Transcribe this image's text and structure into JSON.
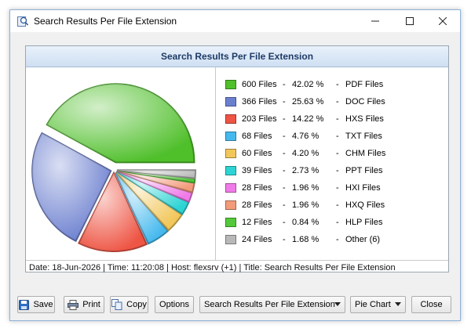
{
  "window": {
    "title": "Search Results Per File Extension"
  },
  "chart_data": {
    "type": "pie",
    "title": "Search Results Per File Extension",
    "slices": [
      {
        "files": "600 Files",
        "percent": "42.02 %",
        "label": "PDF Files",
        "value": 600,
        "color": "#4fbf2a"
      },
      {
        "files": "366 Files",
        "percent": "25.63 %",
        "label": "DOC Files",
        "value": 366,
        "color": "#6b7fcf"
      },
      {
        "files": "203 Files",
        "percent": "14.22 %",
        "label": "HXS Files",
        "value": 203,
        "color": "#ee5544"
      },
      {
        "files": "68 Files",
        "percent": "4.76 %",
        "label": "TXT Files",
        "value": 68,
        "color": "#45b9ee"
      },
      {
        "files": "60 Files",
        "percent": "4.20 %",
        "label": "CHM Files",
        "value": 60,
        "color": "#f2c75a"
      },
      {
        "files": "39 Files",
        "percent": "2.73 %",
        "label": "PPT Files",
        "value": 39,
        "color": "#2ed4d4"
      },
      {
        "files": "28 Files",
        "percent": "1.96 %",
        "label": "HXI Files",
        "value": 28,
        "color": "#f07be8"
      },
      {
        "files": "28 Files",
        "percent": "1.96 %",
        "label": "HXQ Files",
        "value": 28,
        "color": "#f39a7a"
      },
      {
        "files": "12 Files",
        "percent": "0.84 %",
        "label": "HLP Files",
        "value": 12,
        "color": "#53c93a"
      },
      {
        "files": "24 Files",
        "percent": "1.68 %",
        "label": "Other (6)",
        "value": 24,
        "color": "#b8b8b8"
      }
    ]
  },
  "legend_separator": "-",
  "status": "Date: 18-Jun-2026 | Time: 11:20:08 | Host: flexsrv (+1) | Title: Search Results Per File Extension",
  "buttons": {
    "save": "Save",
    "print": "Print",
    "copy": "Copy",
    "options": "Options",
    "close": "Close"
  },
  "selects": {
    "chart_title_value": "Search Results Per File Extension",
    "chart_type_value": "Pie Chart"
  },
  "icons": {
    "app": "app-icon",
    "save": "floppy-disk-icon",
    "print": "printer-icon",
    "copy": "copy-icon"
  }
}
